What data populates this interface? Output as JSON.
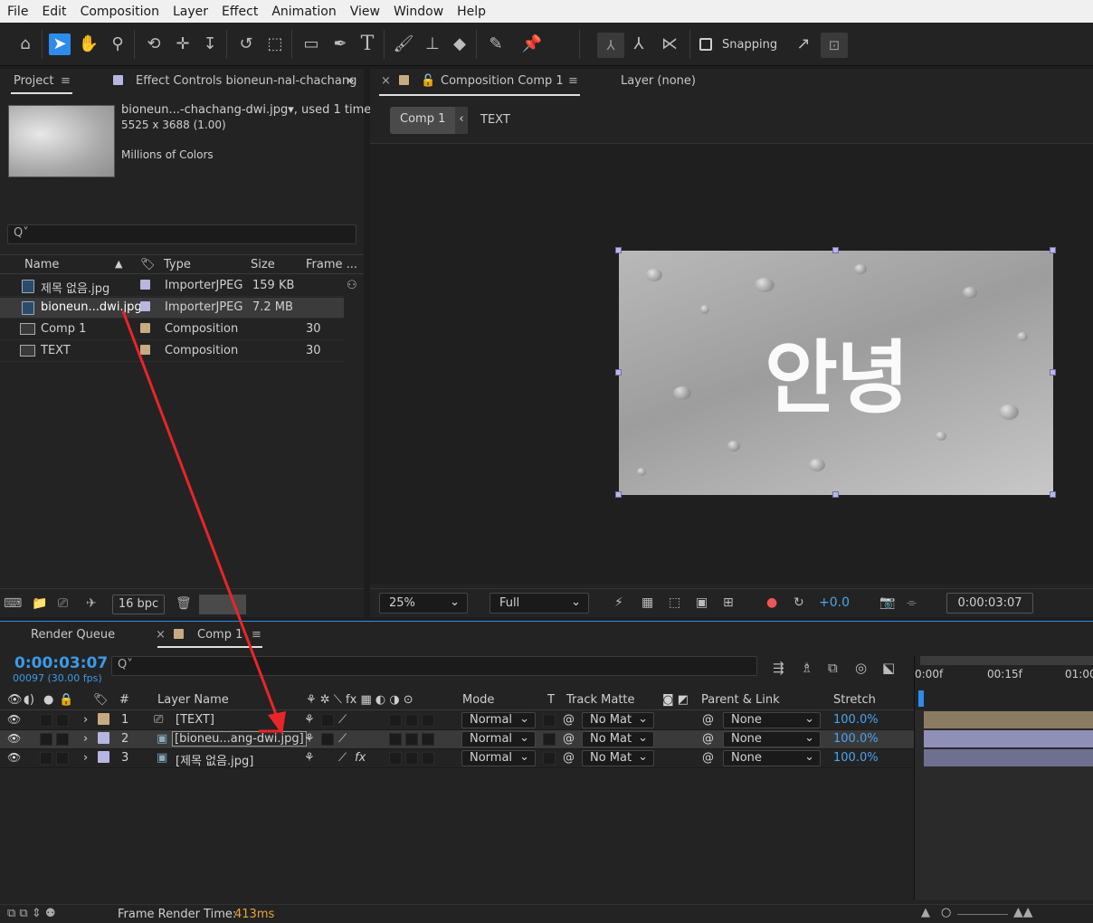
{
  "menu": [
    "File",
    "Edit",
    "Composition",
    "Layer",
    "Effect",
    "Animation",
    "View",
    "Window",
    "Help"
  ],
  "toolbar": {
    "snapping_label": "Snapping",
    "icons": [
      "home-icon",
      "selection-tool-icon",
      "hand-tool-icon",
      "zoom-tool-icon",
      "orbit-camera-icon",
      "pan-camera-icon",
      "dolly-camera-icon",
      "rotate-tool-icon",
      "pan-behind-icon",
      "rectangle-tool-icon",
      "pen-tool-icon",
      "type-tool-icon",
      "brush-tool-icon",
      "clone-stamp-icon",
      "eraser-icon",
      "roto-brush-icon",
      "puppet-pin-icon"
    ]
  },
  "project": {
    "tab_label": "Project",
    "effect_tab_label": "Effect Controls bioneun-nal-chachang",
    "selected_name": "bioneun...-chachang-dwi.jpg",
    "used_label": ", used 1 time",
    "dimensions": "5525 x 3688 (1.00)",
    "colors": "Millions of Colors",
    "search_placeholder": "Q˅",
    "headers": {
      "name": "Name",
      "type": "Type",
      "size": "Size",
      "frame": "Frame ..."
    },
    "items": [
      {
        "name": "제목 없음.jpg",
        "type": "ImporterJPEG",
        "size": "159 KB",
        "frame": "",
        "swatch": "#b6b6e0",
        "kind": "file"
      },
      {
        "name": "bioneun...dwi.jpg",
        "type": "ImporterJPEG",
        "size": "7.2 MB",
        "frame": "",
        "swatch": "#b6b6e0",
        "kind": "file"
      },
      {
        "name": "Comp 1",
        "type": "Composition",
        "size": "",
        "frame": "30",
        "swatch": "#c8aa82",
        "kind": "comp"
      },
      {
        "name": "TEXT",
        "type": "Composition",
        "size": "",
        "frame": "30",
        "swatch": "#c8aa82",
        "kind": "comp"
      }
    ],
    "bpc_label": "16 bpc"
  },
  "composition": {
    "tab_label": "Composition Comp 1",
    "layer_tab_label": "Layer (none)",
    "crumb_active": "Comp 1",
    "crumb_next": "TEXT",
    "canvas_text": "안녕",
    "zoom": "25%",
    "resolution": "Full",
    "exposure": "+0.0",
    "timecode": "0:00:03:07"
  },
  "timeline": {
    "render_queue_label": "Render Queue",
    "comp_tab_label": "Comp 1",
    "current_time": "0:00:03:07",
    "frame_info": "00097 (30.00 fps)",
    "search_placeholder": "Q˅",
    "headers": {
      "num": "#",
      "layer_name": "Layer Name",
      "mode": "Mode",
      "t": "T",
      "track_matte": "Track Matte",
      "parent": "Parent & Link",
      "stretch": "Stretch"
    },
    "ruler": [
      "0:00f",
      "00:15f",
      "01:00"
    ],
    "layers": [
      {
        "num": "1",
        "name": "[TEXT]",
        "mode": "Normal",
        "matte": "No Mat",
        "parent": "None",
        "stretch": "100.0%",
        "swatch": "#c8aa82",
        "bar": "#8c7b63"
      },
      {
        "num": "2",
        "name": "[bioneu...ang-dwi.jpg]",
        "mode": "Normal",
        "matte": "No Mat",
        "parent": "None",
        "stretch": "100.0%",
        "swatch": "#b6b6e0",
        "bar": "#8f8fb8"
      },
      {
        "num": "3",
        "name": "[제목 없음.jpg]",
        "mode": "Normal",
        "matte": "No Mat",
        "parent": "None",
        "stretch": "100.0%",
        "swatch": "#b6b6e0",
        "bar": "#6f6f90"
      }
    ],
    "render_time_label": "Frame Render Time:",
    "render_time_value": "413ms"
  },
  "colors": {
    "accent": "#2d8ceb",
    "time_blue": "#3b9be8",
    "render_orange": "#e8a33a",
    "annotation_red": "#e8252a"
  }
}
